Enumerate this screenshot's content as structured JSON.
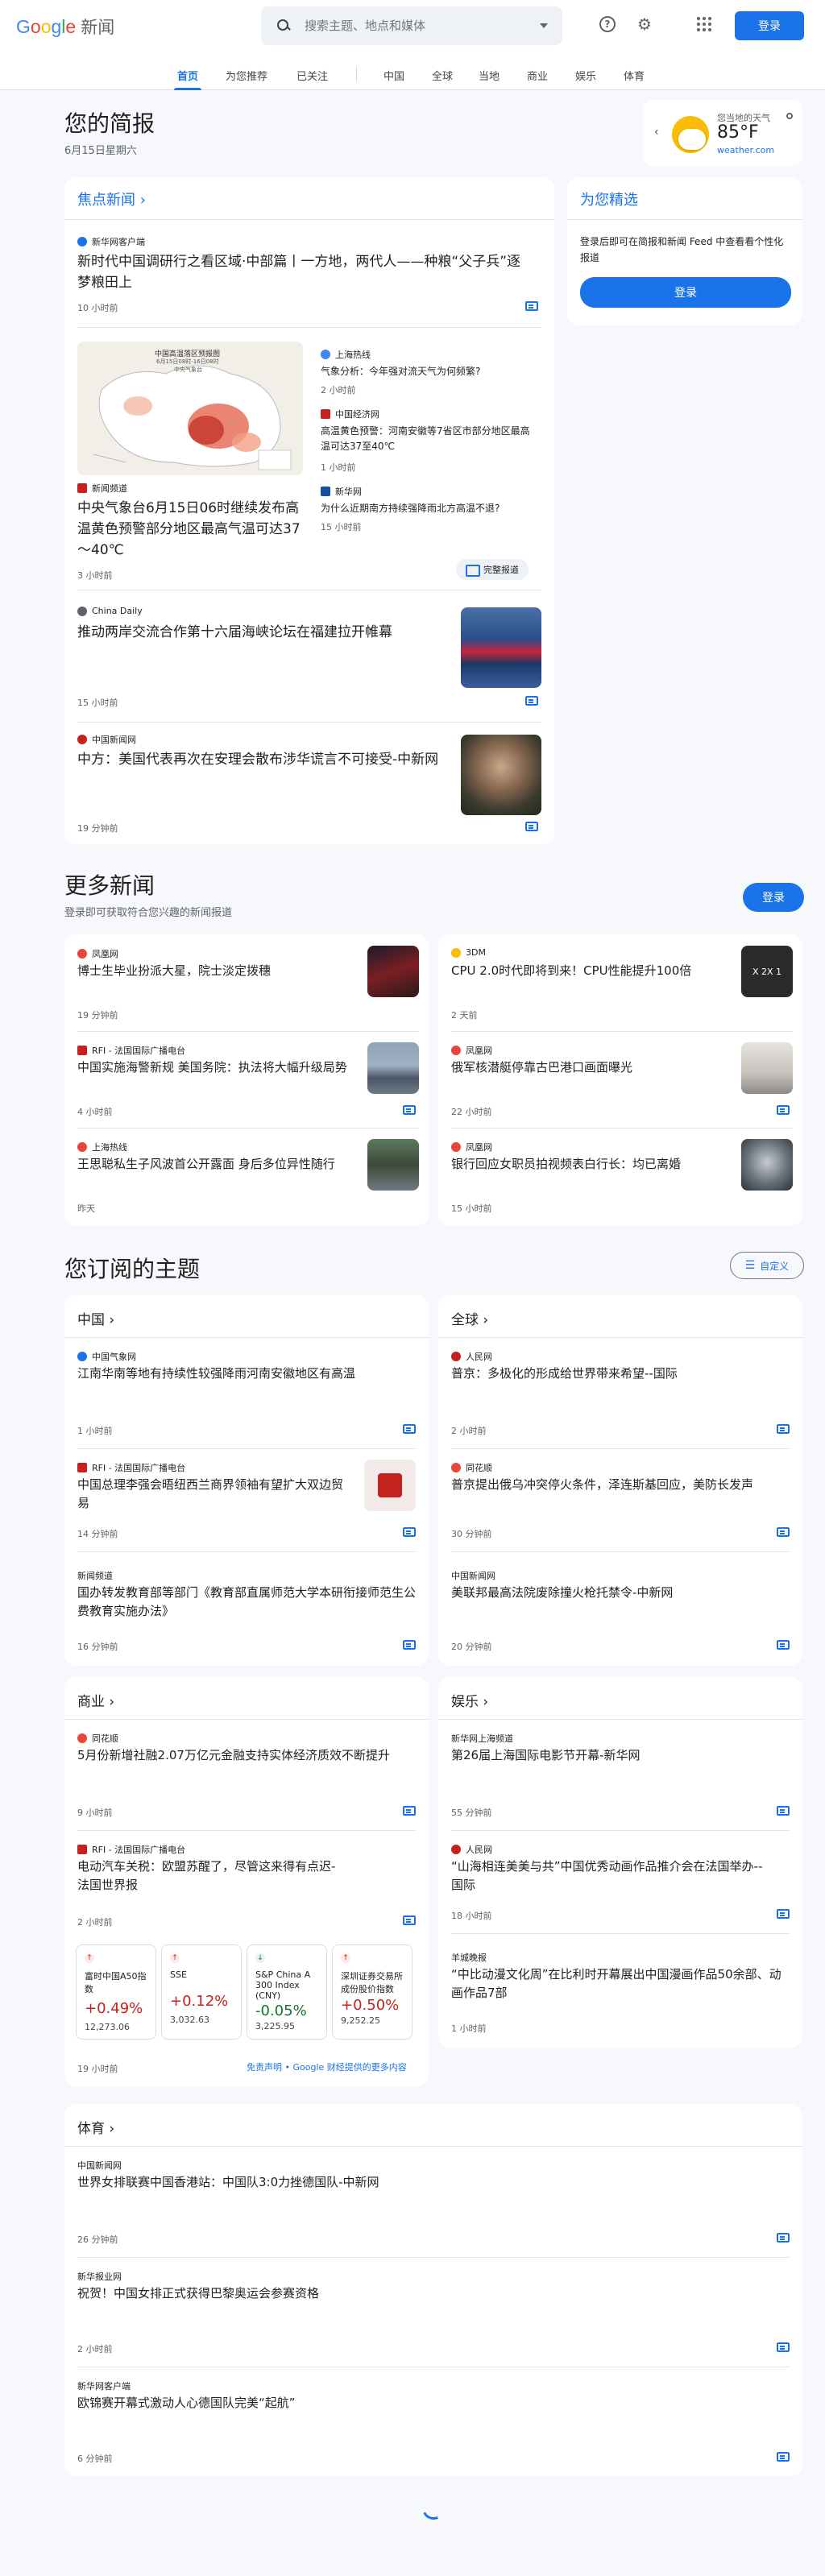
{
  "header": {
    "logo_google": [
      "G",
      "o",
      "o",
      "g",
      "l",
      "e"
    ],
    "logo_suffix": "新闻",
    "search_placeholder": "搜索主题、地点和媒体",
    "login": "登录"
  },
  "nav": {
    "tabs": [
      "首页",
      "为您推荐",
      "已关注",
      "中国",
      "全球",
      "当地",
      "商业",
      "娱乐",
      "体育"
    ],
    "active": "首页"
  },
  "briefing": {
    "title": "您的简报",
    "date": "6月15日星期六"
  },
  "weather": {
    "label": "您当地的天气",
    "temp": "85°F",
    "source": "weather.com"
  },
  "top_stories": {
    "title": "焦点新闻",
    "story1": {
      "source": "新华网客户端",
      "title": "新时代中国调研行之看区域·中部篇丨一方地，两代人——种粮“父子兵”逐梦粮田上",
      "time": "10 小时前"
    },
    "cluster": {
      "main_source": "新闻频道",
      "main_title": "中央气象台6月15日06时继续发布高温黄色预警部分地区最高气温可达37～40℃",
      "main_time": "3 小时前",
      "map_title": "中国高温落区预报图",
      "map_subtitle": "6月15日08时-16日08时",
      "map_org": "中央气象台",
      "related": [
        {
          "source": "上海热线",
          "title": "气象分析：今年强对流天气为何频繁?",
          "time": "2 小时前"
        },
        {
          "source": "中国经济网",
          "title": "高温黄色预警：河南安徽等7省区市部分地区最高温可达37至40℃",
          "time": "1 小时前"
        },
        {
          "source": "新华网",
          "title": "为什么近期南方持续强降雨北方高温不退?",
          "time": "15 小时前"
        }
      ],
      "full_coverage": "完整报道"
    },
    "story3": {
      "source": "China Daily",
      "title": "推动两岸交流合作第十六届海峡论坛在福建拉开帷幕",
      "time": "15 小时前"
    },
    "story4": {
      "source": "中国新闻网",
      "title": "中方：美国代表再次在安理会散布涉华谎言不可接受-中新网",
      "time": "19 分钟前"
    }
  },
  "for_you": {
    "title": "为您精选",
    "desc": "登录后即可在简报和新闻 Feed 中查看看个性化报道",
    "button": "登录"
  },
  "more_news": {
    "title": "更多新闻",
    "subtitle": "登录即可获取符合您兴趣的新闻报道",
    "button": "登录",
    "items": [
      {
        "source": "凤凰网",
        "title": "博士生毕业扮派大星，院士淡定拨穗",
        "time": "19 分钟前"
      },
      {
        "source": "3DM",
        "title": "CPU 2.0时代即将到来！CPU性能提升100倍",
        "time": "2 天前",
        "thumb_text": "X  2X  1"
      },
      {
        "source": "RFI - 法国国际广播电台",
        "title": "中国实施海警新规 美国务院：执法将大幅升级局势",
        "time": "4 小时前"
      },
      {
        "source": "凤凰网",
        "title": "俄军核潜艇停靠古巴港口画面曝光",
        "time": "22 小时前"
      },
      {
        "source": "上海热线",
        "title": "王思聪私生子风波首公开露面 身后多位异性随行",
        "time": "昨天"
      },
      {
        "source": "凤凰网",
        "title": "银行回应女职员拍视频表白行长：均已离婚",
        "time": "15 小时前"
      }
    ]
  },
  "topics": {
    "title": "您订阅的主题",
    "customize": "自定义",
    "china": {
      "name": "中国",
      "items": [
        {
          "source": "中国气象网",
          "title": "江南华南等地有持续性较强降雨河南安徽地区有高温",
          "time": "1 小时前"
        },
        {
          "source": "RFI - 法国国际广播电台",
          "title": "中国总理李强会晤纽西兰商界领袖有望扩大双边贸易",
          "time": "14 分钟前"
        },
        {
          "source": "新闻频道",
          "title": "国办转发教育部等部门《教育部直属师范大学本研衔接师范生公费教育实施办法》",
          "time": "16 分钟前"
        }
      ]
    },
    "world": {
      "name": "全球",
      "items": [
        {
          "source": "人民网",
          "title": "普京：多极化的形成给世界带来希望--国际",
          "time": "2 小时前"
        },
        {
          "source": "同花顺",
          "title": "普京提出俄乌冲突停火条件，泽连斯基回应，美防长发声",
          "time": "30 分钟前"
        },
        {
          "source": "中国新闻网",
          "title": "美联邦最高法院废除撞火枪托禁令-中新网",
          "time": "20 分钟前"
        }
      ]
    },
    "business": {
      "name": "商业",
      "items": [
        {
          "source": "同花顺",
          "title": "5月份新增社融2.07万亿元金融支持实体经济质效不断提升",
          "time": "9 小时前"
        },
        {
          "source": "RFI - 法国国际广播电台",
          "title": "电动汽车关税：欧盟苏醒了，尽管这来得有点迟- 法国世界报",
          "time": "2 小时前"
        }
      ],
      "stocks": [
        {
          "name": "富时中国A50指数",
          "change": "+0.49%",
          "value": "12,273.06",
          "dir": "up"
        },
        {
          "name": "SSE",
          "change": "+0.12%",
          "value": "3,032.63",
          "dir": "up"
        },
        {
          "name": "S&P China A 300 Index (CNY)",
          "change": "-0.05%",
          "value": "3,225.95",
          "dir": "down"
        },
        {
          "name": "深圳证券交易所成份股价指数",
          "change": "+0.50%",
          "value": "9,252.25",
          "dir": "up"
        }
      ],
      "stock_time": "19 小时前",
      "disclaimer": "免责声明 • Google 财经提供的更多内容"
    },
    "entertainment": {
      "name": "娱乐",
      "items": [
        {
          "source": "新华网上海频道",
          "title": "第26届上海国际电影节开幕-新华网",
          "time": "55 分钟前"
        },
        {
          "source": "人民网",
          "title": "“山海相连美美与共”中国优秀动画作品推介会在法国举办--国际",
          "time": "18 小时前"
        },
        {
          "source": "羊城晚报",
          "title": "“中比动漫文化周”在比利时开幕展出中国漫画作品50余部、动画作品7部",
          "time": "1 小时前"
        }
      ]
    },
    "sports": {
      "name": "体育",
      "items": [
        {
          "source": "中国新闻网",
          "title": "世界女排联赛中国香港站：中国队3:0力挫德国队-中新网",
          "time": "26 分钟前"
        },
        {
          "source": "新华报业网",
          "title": "祝贺！中国女排正式获得巴黎奥运会参赛资格",
          "time": "2 小时前"
        },
        {
          "source": "新华网客户端",
          "title": "欧锦赛开幕式激动人心德国队完美“起航”",
          "time": "6 分钟前"
        }
      ]
    }
  },
  "colors": {
    "accent": "#1a73e8",
    "up": "#c5221f",
    "down": "#137333",
    "bg": "#f6f8fc"
  }
}
